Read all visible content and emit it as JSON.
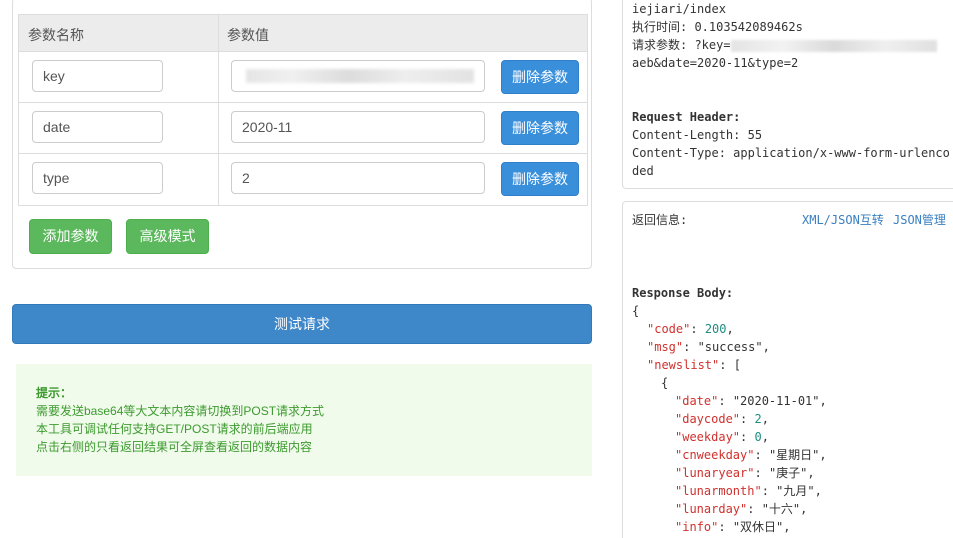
{
  "params": {
    "header_name": "参数名称",
    "header_value": "参数值",
    "rows": [
      {
        "name": "key",
        "value": ""
      },
      {
        "name": "date",
        "value": "2020-11"
      },
      {
        "name": "type",
        "value": "2"
      }
    ],
    "delete_label": "删除参数",
    "add_label": "添加参数",
    "advanced_label": "高级模式"
  },
  "test_button": "测试请求",
  "tips": {
    "title": "提示：",
    "lines": [
      "需要发送base64等大文本内容请切换到POST请求方式",
      "本工具可调试任何支持GET/POST请求的前后端应用",
      "点击右侧的只看返回结果可全屏查看返回的数据内容"
    ]
  },
  "request": {
    "url_tail": "iejiari/index",
    "exec_time": "执行时间: 0.103542089462s",
    "params_prefix": "请求参数: ?key=",
    "params_line2": "aeb&date=2020-11&type=2",
    "header_title": "Request Header:",
    "content_length": "Content-Length: 55",
    "content_type_1": "Content-Type: application/x-www-form-urlenco",
    "content_type_2": "ded"
  },
  "response": {
    "label": "返回信息:",
    "xml_json_link": "XML/JSON互转",
    "json_manage_link": "JSON管理",
    "body_title": "Response Body:",
    "body": {
      "code": "200",
      "msg": "\"success\"",
      "newslist": {
        "date": "\"2020-11-01\"",
        "daycode": "2",
        "weekday": "0",
        "cnweekday": "\"星期日\"",
        "lunaryear": "\"庚子\"",
        "lunarmonth": "\"九月\"",
        "lunarday": "\"十六\"",
        "info": "\"双休日\""
      }
    }
  }
}
